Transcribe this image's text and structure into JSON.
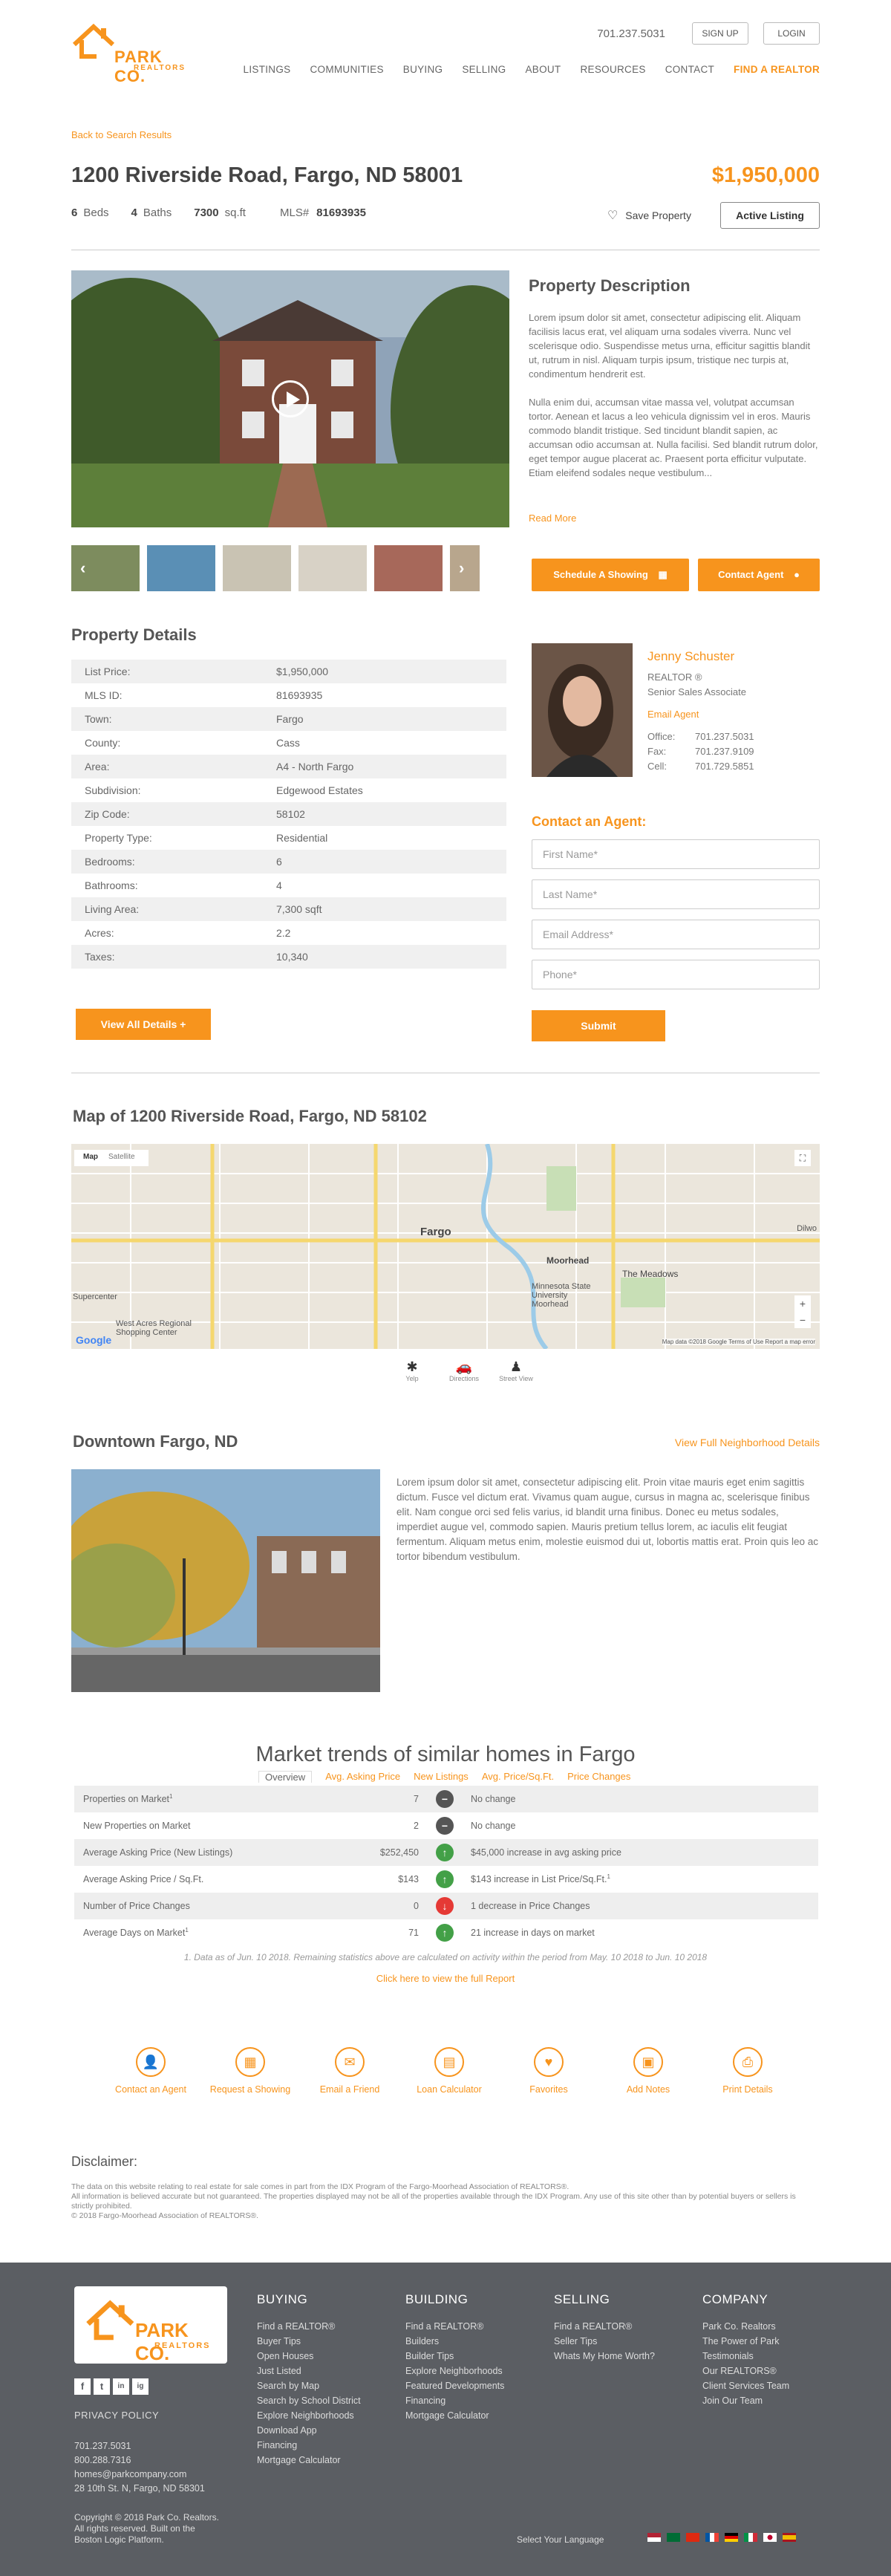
{
  "header": {
    "logo_text": "PARK CO.",
    "logo_sub": "REALTORS",
    "phone": "701.237.5031",
    "sign_up": "SIGN UP",
    "login": "LOGIN",
    "nav": [
      "LISTINGS",
      "COMMUNITIES",
      "BUYING",
      "SELLING",
      "ABOUT",
      "RESOURCES",
      "CONTACT"
    ],
    "nav_find": "FIND A REALTOR"
  },
  "listing": {
    "back": "Back to Search Results",
    "title": "1200 Riverside Road, Fargo, ND 58001",
    "price": "$1,950,000",
    "beds_num": "6",
    "beds_label": "Beds",
    "baths_num": "4",
    "baths_label": "Baths",
    "sqft_num": "7300",
    "sqft_label": "sq.ft",
    "mls_label": "MLS#",
    "mls_num": "81693935",
    "save": "Save Property",
    "status": "Active Listing"
  },
  "description": {
    "title": "Property Description",
    "p1": "Lorem ipsum dolor sit amet, consectetur adipiscing elit. Aliquam facilisis lacus erat, vel aliquam urna sodales viverra. Nunc vel scelerisque odio. Suspendisse metus urna, efficitur sagittis blandit ut, rutrum in nisl. Aliquam turpis ipsum, tristique nec turpis at, condimentum hendrerit est.",
    "p2": "Nulla enim dui, accumsan vitae massa vel, volutpat accumsan tortor. Aenean et lacus a leo vehicula dignissim vel in eros. Mauris commodo blandit tristique. Sed tincidunt blandit sapien, ac accumsan odio accumsan at. Nulla facilisi. Sed blandit rutrum dolor, eget tempor augue placerat ac. Praesent porta efficitur vulputate. Etiam eleifend sodales neque vestibulum...",
    "read_more": "Read More",
    "schedule": "Schedule A Showing",
    "contact_agent": "Contact Agent"
  },
  "details": {
    "title": "Property Details",
    "rows": [
      {
        "k": "List Price:",
        "v": "$1,950,000"
      },
      {
        "k": "MLS ID:",
        "v": "81693935"
      },
      {
        "k": "Town:",
        "v": "Fargo"
      },
      {
        "k": "County:",
        "v": "Cass"
      },
      {
        "k": "Area:",
        "v": "A4 - North Fargo"
      },
      {
        "k": "Subdivision:",
        "v": "Edgewood Estates"
      },
      {
        "k": "Zip Code:",
        "v": "58102"
      },
      {
        "k": "Property Type:",
        "v": "Residential"
      },
      {
        "k": "Bedrooms:",
        "v": "6"
      },
      {
        "k": "Bathrooms:",
        "v": "4"
      },
      {
        "k": "Living Area:",
        "v": "7,300 sqft"
      },
      {
        "k": "Acres:",
        "v": "2.2"
      },
      {
        "k": "Taxes:",
        "v": "10,340"
      }
    ],
    "view_all": "View All Details +"
  },
  "agent": {
    "name": "Jenny Schuster",
    "title1": "REALTOR ®",
    "title2": "Senior Sales Associate",
    "email": "Email Agent",
    "office_label": "Office:",
    "office": "701.237.5031",
    "fax_label": "Fax:",
    "fax": "701.237.9109",
    "cell_label": "Cell:",
    "cell": "701.729.5851",
    "contact_title": "Contact an Agent:",
    "fields": [
      "First Name*",
      "Last Name*",
      "Email Address*",
      "Phone*"
    ],
    "submit": "Submit"
  },
  "map": {
    "title": "Map of 1200 Riverside Road, Fargo, ND 58102",
    "map_btn": "Map",
    "sat_btn": "Satellite",
    "labels": {
      "fargo": "Fargo",
      "moorhead": "Moorhead",
      "meadows": "The Meadows",
      "msu": "Minnesota State University Moorhead",
      "west_acres": "West Acres Regional Shopping Center",
      "supercenter": "Supercenter",
      "dilworth": "Dilwo",
      "google": "Google",
      "footer": "Map data ©2018 Google   Terms of Use   Report a map error"
    },
    "icons": [
      {
        "label": "Yelp",
        "icon": "yelp-icon"
      },
      {
        "label": "Directions",
        "icon": "car-icon"
      },
      {
        "label": "Street View",
        "icon": "pegman-icon"
      }
    ]
  },
  "neighborhood": {
    "title": "Downtown Fargo, ND",
    "link": "View Full Neighborhood Details",
    "text": "Lorem ipsum dolor sit amet, consectetur adipiscing elit. Proin vitae mauris eget enim sagittis dictum. Fusce vel dictum erat. Vivamus quam augue, cursus in magna ac, scelerisque finibus elit. Nam congue orci sed felis varius, id blandit urna finibus. Donec eu metus sodales, imperdiet augue vel, commodo sapien. Mauris pretium tellus lorem, ac iaculis elit feugiat fermentum. Aliquam metus enim, molestie euismod dui ut, lobortis mattis erat. Proin quis leo ac tortor bibendum vestibulum."
  },
  "market": {
    "title": "Market trends of similar homes in Fargo",
    "tabs": [
      "Overview",
      "Avg. Asking Price",
      "New Listings",
      "Avg. Price/Sq.Ft.",
      "Price Changes"
    ],
    "rows": [
      {
        "label": "Properties on Market",
        "sup": "1",
        "value": "7",
        "trend": "flat",
        "text": "No change"
      },
      {
        "label": "New Properties on Market",
        "sup": "",
        "value": "2",
        "trend": "flat",
        "text": "No change"
      },
      {
        "label": "Average Asking Price (New Listings)",
        "sup": "",
        "value": "$252,450",
        "trend": "up",
        "text": "$45,000 increase in avg asking price"
      },
      {
        "label": "Average Asking Price / Sq.Ft.",
        "sup": "",
        "value": "$143",
        "trend": "up",
        "text": "$143 increase in List Price/Sq.Ft.",
        "text_sup": "1"
      },
      {
        "label": "Number of Price Changes",
        "sup": "",
        "value": "0",
        "trend": "down",
        "text": "1 decrease in Price Changes"
      },
      {
        "label": "Average Days on Market",
        "sup": "1",
        "value": "71",
        "trend": "up",
        "text": "21 increase in days on market"
      }
    ],
    "note": "1. Data as of Jun. 10 2018. Remaining statistics above are calculated on activity within the period from May. 10 2018 to Jun. 10 2018",
    "link": "Click here to view the full Report"
  },
  "actions": [
    {
      "label": "Contact an Agent",
      "icon": "person-icon"
    },
    {
      "label": "Request a Showing",
      "icon": "calendar-icon"
    },
    {
      "label": "Email a Friend",
      "icon": "email-icon"
    },
    {
      "label": "Loan Calculator",
      "icon": "calculator-icon"
    },
    {
      "label": "Favorites",
      "icon": "heart-icon"
    },
    {
      "label": "Add Notes",
      "icon": "notes-icon"
    },
    {
      "label": "Print Details",
      "icon": "printer-icon"
    }
  ],
  "disclaimer": {
    "title": "Disclaimer:",
    "l1": "The data on this website relating to real estate for sale comes in part from the IDX Program of the Fargo-Moorhead Association of REALTORS®.",
    "l2": "All information is believed accurate but not guaranteed. The properties displayed may not be all of the properties available through the IDX Program. Any use of this site other than by potential buyers or sellers is strictly prohibited.",
    "l3": "© 2018 Fargo-Moorhead Association of REALTORS®."
  },
  "footer": {
    "privacy": "PRIVACY POLICY",
    "phone1": "701.237.5031",
    "phone2": "800.288.7316",
    "email": "homes@parkcompany.com",
    "address": "28 10th St. N, Fargo, ND 58301",
    "copy1": "Copyright © 2018 Park Co. Realtors.",
    "copy2": "All rights reserved. Built on the",
    "copy3": "Boston Logic Platform.",
    "columns": [
      {
        "h": "BUYING",
        "items": [
          "Find a REALTOR®",
          "Buyer Tips",
          "Open Houses",
          "Just Listed",
          "Search by Map",
          "Search by School District",
          "Explore Neighborhoods",
          "Download App",
          "Financing",
          "Mortgage Calculator"
        ]
      },
      {
        "h": "BUILDING",
        "items": [
          "Find a REALTOR®",
          "Builders",
          "Builder Tips",
          "Explore Neighborhoods",
          "Featured Developments",
          "Financing",
          "Mortgage Calculator"
        ]
      },
      {
        "h": "SELLING",
        "items": [
          "Find a REALTOR®",
          "Seller Tips",
          "Whats My Home Worth?"
        ]
      },
      {
        "h": "COMPANY",
        "items": [
          "Park Co. Realtors",
          "The Power of Park",
          "Testimonials",
          "Our REALTORS®",
          "Client Services Team",
          "Join Our Team"
        ]
      }
    ],
    "language": "Select Your Language",
    "social": [
      "f",
      "t",
      "in",
      "ig"
    ]
  },
  "colors": {
    "accent": "#f7941d",
    "footer_bg": "#5b5e63"
  }
}
